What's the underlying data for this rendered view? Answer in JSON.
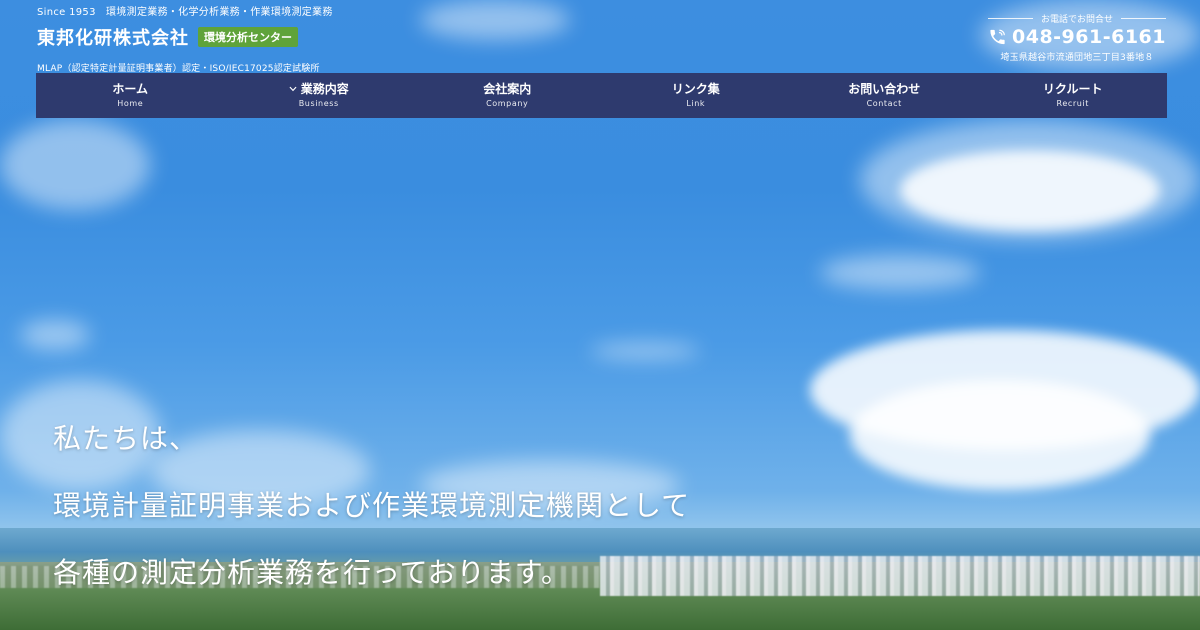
{
  "header": {
    "tagline": "Since 1953　環境測定業務・化学分析業務・作業環境測定業務",
    "company_name": "東邦化研株式会社",
    "center_badge": "環境分析センター",
    "certification": "MLAP（認定特定計量証明事業者）認定・ISO/IEC17025認定試験所",
    "contact_label": "お電話でお問合せ",
    "phone": "048-961-6161",
    "address": "埼玉県越谷市流通団地三丁目3番地８"
  },
  "nav": {
    "items": [
      {
        "label": "ホーム",
        "sub": "Home"
      },
      {
        "label": "業務内容",
        "sub": "Business"
      },
      {
        "label": "会社案内",
        "sub": "Company"
      },
      {
        "label": "リンク集",
        "sub": "Link"
      },
      {
        "label": "お問い合わせ",
        "sub": "Contact"
      },
      {
        "label": "リクルート",
        "sub": "Recruit"
      }
    ]
  },
  "hero": {
    "lines": [
      "私たちは、",
      "環境計量証明事業および作業環境測定機関として",
      "各種の測定分析業務を行っております。"
    ]
  },
  "colors": {
    "nav_bg": "#2e3a6e",
    "badge_green": "#5fa33a",
    "sky": "#3d8ee0"
  },
  "icons": {
    "phone": "phone-icon",
    "dropdown": "chevron-down-icon"
  }
}
